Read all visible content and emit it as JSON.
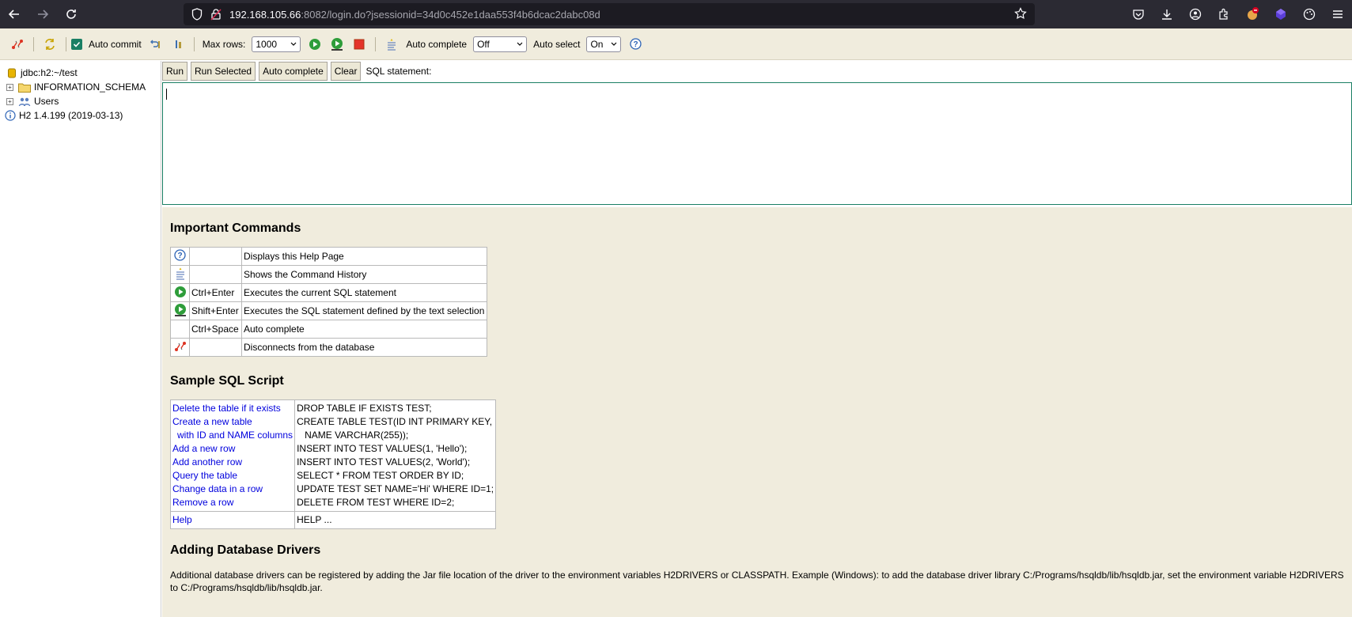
{
  "browser": {
    "url_host": "192.168.105.66",
    "url_rest": ":8082/login.do?jsessionid=34d0c452e1daa553f4b6dcac2dabc08d"
  },
  "toolbar": {
    "auto_commit_label": "Auto commit",
    "max_rows_label": "Max rows:",
    "max_rows_value": "1000",
    "auto_complete_label": "Auto complete",
    "auto_complete_value": "Off",
    "auto_select_label": "Auto select",
    "auto_select_value": "On"
  },
  "tree": {
    "connection": "jdbc:h2:~/test",
    "items": [
      {
        "label": "INFORMATION_SCHEMA"
      },
      {
        "label": "Users"
      }
    ],
    "version": "H2 1.4.199 (2019-03-13)"
  },
  "query": {
    "run": "Run",
    "run_selected": "Run Selected",
    "auto_complete": "Auto complete",
    "clear": "Clear",
    "sql_label": "SQL statement:"
  },
  "help": {
    "important_title": "Important Commands",
    "commands": [
      {
        "icon": "help-icon",
        "key": "",
        "desc": "Displays this Help Page"
      },
      {
        "icon": "history-icon",
        "key": "",
        "desc": "Shows the Command History"
      },
      {
        "icon": "run-icon",
        "key": "Ctrl+Enter",
        "desc": "Executes the current SQL statement"
      },
      {
        "icon": "run-selected-icon",
        "key": "Shift+Enter",
        "desc": "Executes the SQL statement defined by the text selection"
      },
      {
        "icon": "",
        "key": "Ctrl+Space",
        "desc": "Auto complete"
      },
      {
        "icon": "disconnect-icon",
        "key": "",
        "desc": "Disconnects from the database"
      }
    ],
    "sample_title": "Sample SQL Script",
    "sample_links": [
      "Delete the table if it exists",
      "Create a new table",
      "  with ID and NAME columns",
      "Add a new row",
      "Add another row",
      "Query the table",
      "Change data in a row",
      "Remove a row"
    ],
    "sample_sql": [
      "DROP TABLE IF EXISTS TEST;",
      "CREATE TABLE TEST(ID INT PRIMARY KEY,",
      "   NAME VARCHAR(255));",
      "INSERT INTO TEST VALUES(1, 'Hello');",
      "INSERT INTO TEST VALUES(2, 'World');",
      "SELECT * FROM TEST ORDER BY ID;",
      "UPDATE TEST SET NAME='Hi' WHERE ID=1;",
      "DELETE FROM TEST WHERE ID=2;"
    ],
    "help_link": "Help",
    "help_sql": "HELP ...",
    "drivers_title": "Adding Database Drivers",
    "drivers_text": "Additional database drivers can be registered by adding the Jar file location of the driver to the environment variables H2DRIVERS or CLASSPATH. Example (Windows): to add the database driver library C:/Programs/hsqldb/lib/hsqldb.jar, set the environment variable H2DRIVERS to C:/Programs/hsqldb/lib/hsqldb.jar."
  }
}
